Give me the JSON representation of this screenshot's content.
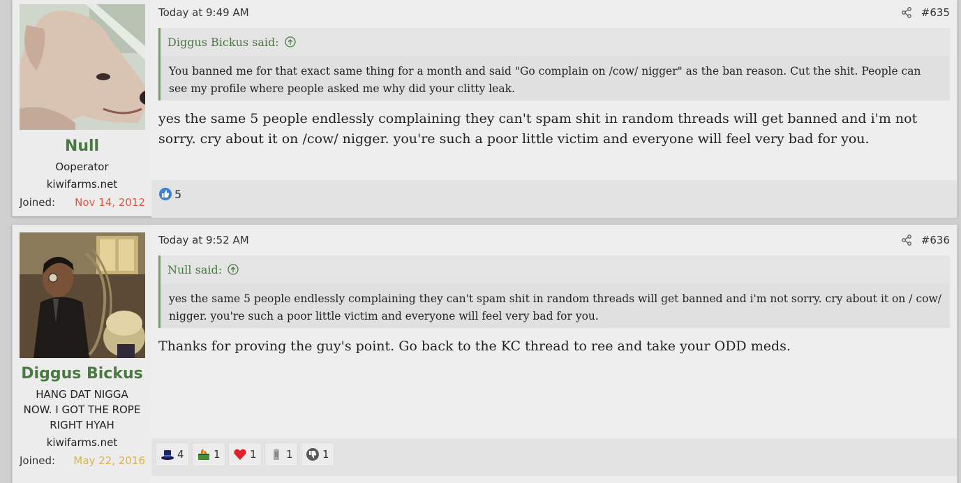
{
  "posts": [
    {
      "user": {
        "name": "Null",
        "title_lines": [
          "Ooperator"
        ],
        "site": "kiwifarms.net",
        "joined_label": "Joined:",
        "joined_date": "Nov 14, 2012",
        "joined_color": "#e05546",
        "avatar": "dog-avatar"
      },
      "time": "Today at 9:49 AM",
      "number": "#635",
      "quote": {
        "author_line": "Diggus Bickus said:",
        "text": "You banned me for that exact same thing for a month and said \"Go complain on /cow/ nigger\" as the ban reason. Cut the shit. People can see my profile where people asked me why did your clitty leak."
      },
      "body": "yes the same 5 people endlessly complaining they can't spam shit in random threads will get banned and i'm not sorry. cry about it on /cow/ nigger. you're such a poor little victim and everyone will feel very bad for you.",
      "reactions": [
        {
          "icon": "like-icon",
          "count": "5"
        }
      ]
    },
    {
      "user": {
        "name": "Diggus Bickus",
        "title_lines": [
          "HANG DAT NIGGA",
          "NOW. I GOT THE ROPE",
          "RIGHT HYAH"
        ],
        "site": "kiwifarms.net",
        "joined_label": "Joined:",
        "joined_date": "May 22, 2016",
        "joined_color": "#d9b24a",
        "avatar": "man-with-rope-avatar"
      },
      "time": "Today at 9:52 AM",
      "number": "#636",
      "quote": {
        "author_line": "Null said:",
        "text": "yes the same 5 people endlessly complaining they can't spam shit in random threads will get banned and i'm not sorry. cry about it on / cow/ nigger. you're such a poor little victim and everyone will feel very bad for you."
      },
      "body": "Thanks for proving the guy's point. Go back to the KC thread to ree and take your ODD meds.",
      "reactions": [
        {
          "icon": "top-hat-icon",
          "count": "4"
        },
        {
          "icon": "dumpster-fire-icon",
          "count": "1"
        },
        {
          "icon": "heart-icon",
          "count": "1"
        },
        {
          "icon": "autism-icon",
          "count": "1"
        },
        {
          "icon": "dislike-icon",
          "count": "1"
        }
      ]
    }
  ],
  "colors": {
    "username": "#4a7a42",
    "quote_border": "#6aa35c",
    "background": "#eeeeee"
  }
}
